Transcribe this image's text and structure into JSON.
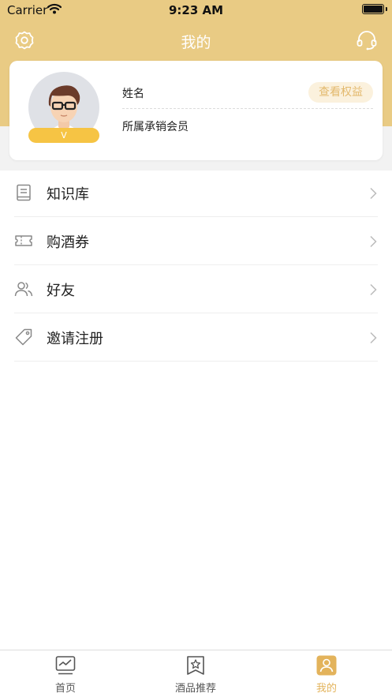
{
  "status_bar": {
    "carrier": "Carrier",
    "time": "9:23 AM"
  },
  "nav": {
    "title": "我的"
  },
  "profile": {
    "name_label": "姓名",
    "benefits_button": "查看权益",
    "member_label": "所属承销会员",
    "vip_badge": "V"
  },
  "menu": {
    "items": [
      {
        "label": "知识库",
        "icon": "book-icon"
      },
      {
        "label": "购酒券",
        "icon": "ticket-icon"
      },
      {
        "label": "好友",
        "icon": "friends-icon"
      },
      {
        "label": "邀请注册",
        "icon": "tag-icon"
      }
    ]
  },
  "tab_bar": {
    "tabs": [
      {
        "label": "首页",
        "icon": "chart-monitor-icon",
        "active": false
      },
      {
        "label": "酒品推荐",
        "icon": "star-bookmark-icon",
        "active": false
      },
      {
        "label": "我的",
        "icon": "user-icon",
        "active": true
      }
    ]
  },
  "colors": {
    "header": "#e9cb84",
    "accent": "#e3b35b",
    "badge": "#f6c444",
    "benefits_bg": "#fbf1dd"
  }
}
